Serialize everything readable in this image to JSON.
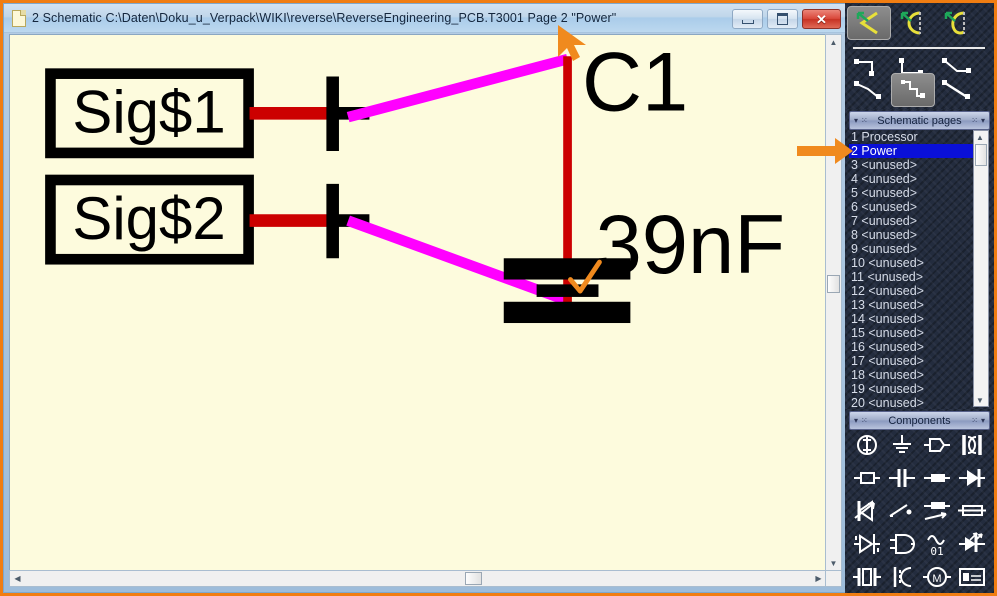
{
  "window": {
    "title": "2 Schematic C:\\Daten\\Doku_u_Verpack\\WIKI\\reverse\\ReverseEngineering_PCB.T3001 Page 2 \"Power\"",
    "doc_icon": "document-icon",
    "buttons": {
      "minimize": "minimize-button",
      "maximize": "maximize-button",
      "close": "close-button",
      "close_glyph": "✕"
    }
  },
  "canvas": {
    "background_color": "#fdfbdd",
    "schematic": {
      "signal_boxes": [
        {
          "label": "Sig$1"
        },
        {
          "label": "Sig$2"
        }
      ],
      "component": {
        "designator": "C1",
        "value": "39nF",
        "symbol": "capacitor-polarized"
      },
      "wire_colors": {
        "pin": "#cc0000",
        "net": "#ff00ff",
        "rail": "#cc0000",
        "symbol": "#000000"
      },
      "annotation_check": "orange-check-mark"
    }
  },
  "scrollbars": {
    "vertical": {
      "up": "▲",
      "down": "▼"
    },
    "horizontal": {
      "left": "◀",
      "right": "▶"
    }
  },
  "toolbar": {
    "row1": [
      {
        "name": "arc-tool-1",
        "selected": true
      },
      {
        "name": "arc-tool-2",
        "selected": false
      },
      {
        "name": "arc-tool-3",
        "selected": false
      }
    ],
    "row2": [
      {
        "name": "route-corner-updown",
        "selected": false
      },
      {
        "name": "route-corner-downup",
        "selected": false
      },
      {
        "name": "route-diagonal-step",
        "selected": false
      }
    ],
    "row3": [
      {
        "name": "route-diagonal-down",
        "selected": false
      },
      {
        "name": "route-staircase",
        "selected": true
      },
      {
        "name": "route-straight-diagonal",
        "selected": false
      }
    ]
  },
  "panels": {
    "schematic_pages": {
      "title": "Schematic pages",
      "collapse_glyph": "▾",
      "grip_glyph": "⁙",
      "menu_glyph": "▾",
      "items": [
        {
          "num": "1",
          "label": "Processor",
          "selected": false
        },
        {
          "num": "2",
          "label": "Power",
          "selected": true
        },
        {
          "num": "3",
          "label": "<unused>",
          "selected": false
        },
        {
          "num": "4",
          "label": "<unused>",
          "selected": false
        },
        {
          "num": "5",
          "label": "<unused>",
          "selected": false
        },
        {
          "num": "6",
          "label": "<unused>",
          "selected": false
        },
        {
          "num": "7",
          "label": "<unused>",
          "selected": false
        },
        {
          "num": "8",
          "label": "<unused>",
          "selected": false
        },
        {
          "num": "9",
          "label": "<unused>",
          "selected": false
        },
        {
          "num": "10",
          "label": "<unused>",
          "selected": false
        },
        {
          "num": "11",
          "label": "<unused>",
          "selected": false
        },
        {
          "num": "12",
          "label": "<unused>",
          "selected": false
        },
        {
          "num": "13",
          "label": "<unused>",
          "selected": false
        },
        {
          "num": "14",
          "label": "<unused>",
          "selected": false
        },
        {
          "num": "15",
          "label": "<unused>",
          "selected": false
        },
        {
          "num": "16",
          "label": "<unused>",
          "selected": false
        },
        {
          "num": "17",
          "label": "<unused>",
          "selected": false
        },
        {
          "num": "18",
          "label": "<unused>",
          "selected": false
        },
        {
          "num": "19",
          "label": "<unused>",
          "selected": false
        },
        {
          "num": "20",
          "label": "<unused>",
          "selected": false
        }
      ]
    },
    "components": {
      "title": "Components",
      "collapse_glyph": "▾",
      "grip_glyph": "⁙",
      "menu_glyph": "▾",
      "items": [
        {
          "name": "voltage-source-icon"
        },
        {
          "name": "ground-icon"
        },
        {
          "name": "connector-icon"
        },
        {
          "name": "ferrite-bead-icon"
        },
        {
          "name": "resistor-icon"
        },
        {
          "name": "capacitor-icon"
        },
        {
          "name": "inductor-icon"
        },
        {
          "name": "diode-icon"
        },
        {
          "name": "zener-arrow-icon"
        },
        {
          "name": "switch-icon"
        },
        {
          "name": "potentiometer-icon"
        },
        {
          "name": "fuse-icon"
        },
        {
          "name": "schmitt-buffer-icon"
        },
        {
          "name": "or-gate-icon"
        },
        {
          "name": "adc-icon"
        },
        {
          "name": "led-icon"
        },
        {
          "name": "crystal-icon"
        },
        {
          "name": "speaker-icon"
        },
        {
          "name": "motor-icon"
        },
        {
          "name": "ic-block-icon"
        }
      ]
    }
  },
  "annotations": {
    "cursor_arrow": "orange-cursor-arrow",
    "pointer_arrow": "orange-right-arrow",
    "accent_color": "#f07d12"
  }
}
